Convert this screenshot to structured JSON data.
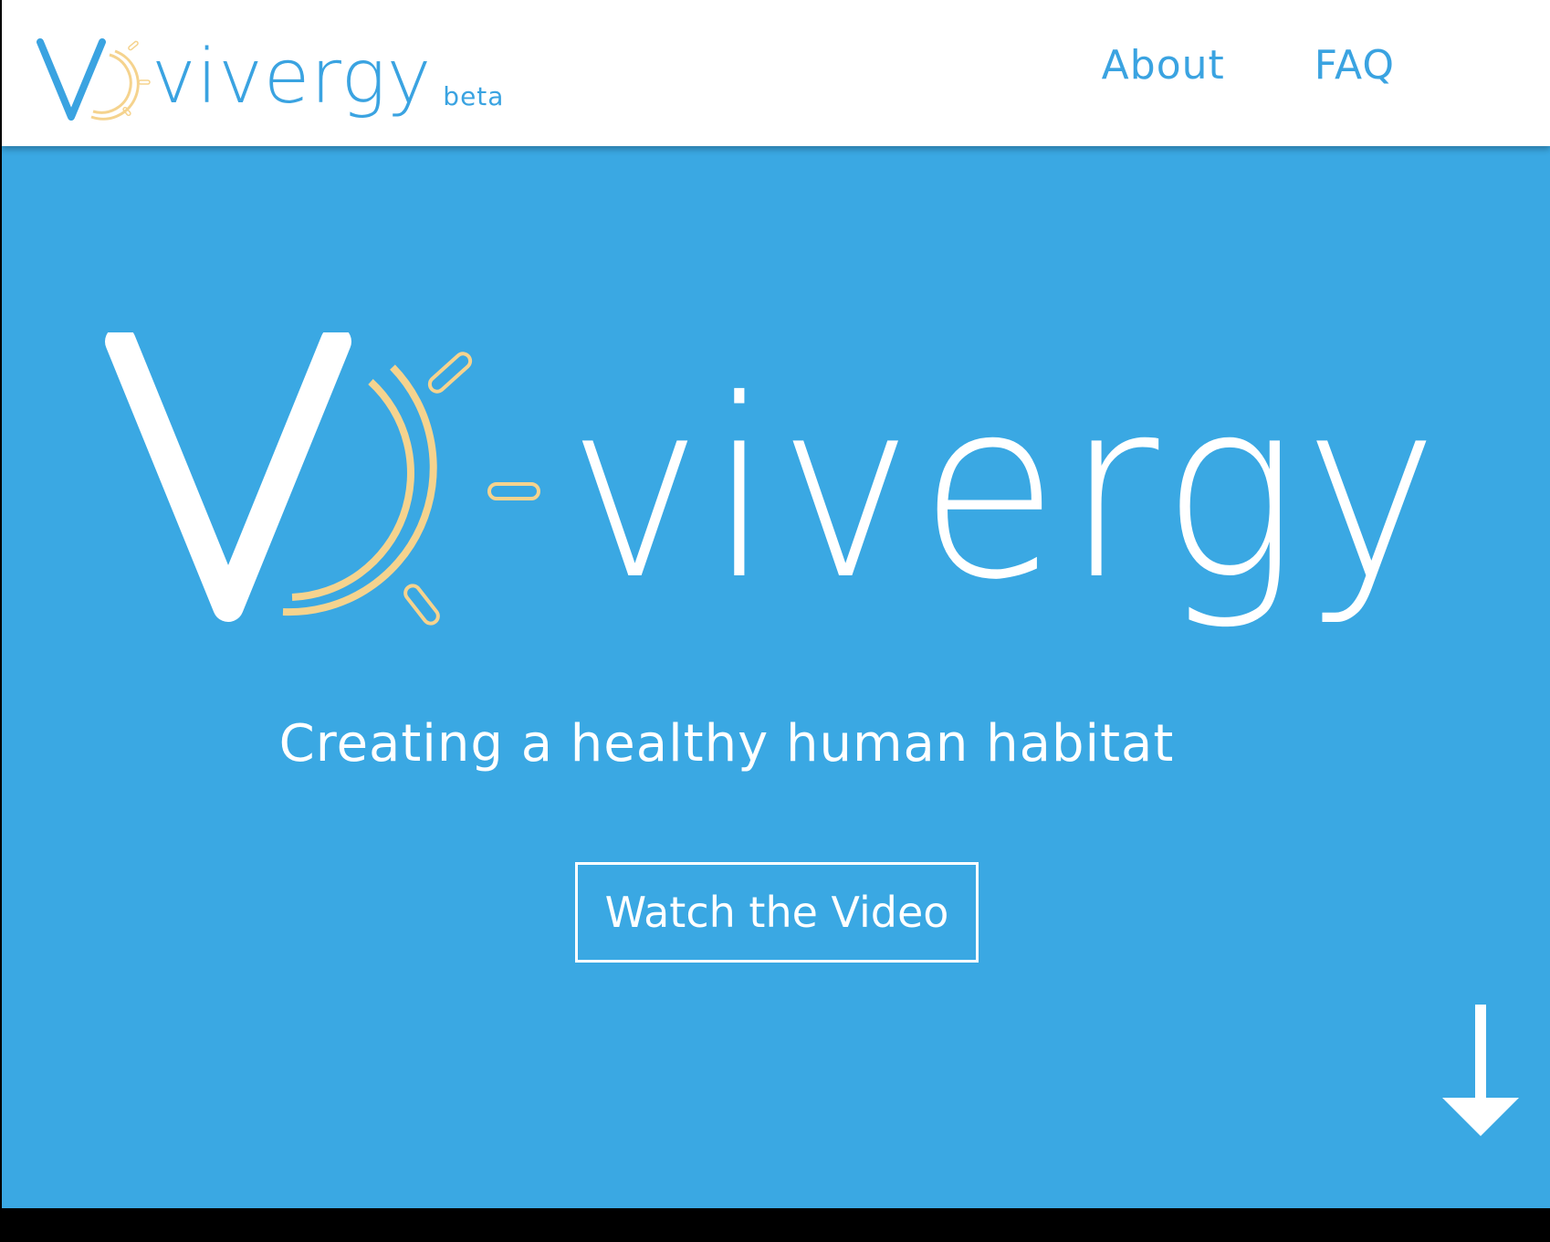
{
  "header": {
    "logo_text": "vivergy",
    "beta_label": "beta",
    "nav": [
      {
        "label": "About"
      },
      {
        "label": "FAQ"
      }
    ]
  },
  "hero": {
    "logo_text": "vivergy",
    "tagline": "Creating a healthy human habitat",
    "cta_label": "Watch the Video"
  },
  "colors": {
    "brand_blue": "#3aa8e3",
    "logo_blue": "#3aa3e1",
    "sun_gold": "#f5d38e",
    "white": "#ffffff"
  },
  "icons": {
    "logo_mark": "v-sun-logo-icon",
    "scroll": "arrow-down-icon"
  }
}
